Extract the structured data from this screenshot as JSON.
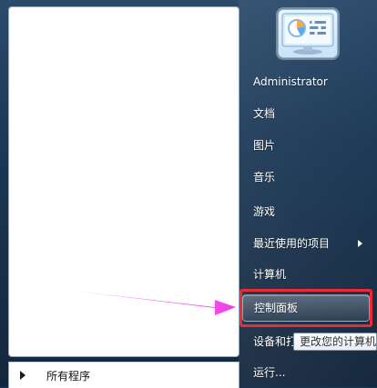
{
  "user": {
    "name": "Administrator",
    "avatar_icon": "monitor-gauge-icon"
  },
  "right_pane": {
    "items": [
      {
        "label": "文档"
      },
      {
        "label": "图片"
      },
      {
        "label": "音乐"
      },
      {
        "label": "游戏"
      },
      {
        "label": "最近使用的项目"
      },
      {
        "label": "计算机"
      },
      {
        "label": "控制面板"
      },
      {
        "label": "设备和打"
      },
      {
        "label": "运行..."
      }
    ]
  },
  "left_pane": {
    "all_programs_label": "所有程序"
  },
  "tooltip": {
    "text": "更改您的计算机设"
  },
  "colors": {
    "highlight_border": "#f02a33",
    "annotation_arrow": "#ee3ee8"
  }
}
